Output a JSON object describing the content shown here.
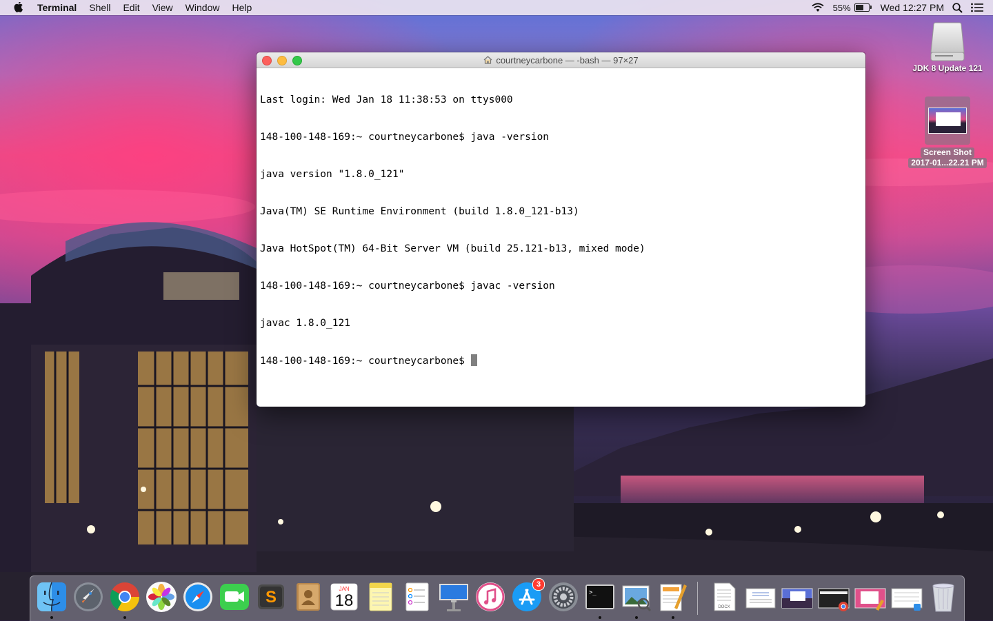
{
  "menubar": {
    "app_name": "Terminal",
    "menus": [
      "Shell",
      "Edit",
      "View",
      "Window",
      "Help"
    ],
    "battery_percent": "55%",
    "battery_level": 0.55,
    "clock": "Wed 12:27 PM"
  },
  "desktop": {
    "icons": [
      {
        "label": "JDK 8 Update 121",
        "icon": "drive-icon"
      },
      {
        "label_line1": "Screen Shot",
        "label_line2": "2017-01...22.21 PM",
        "icon": "screenshot-thumbnail"
      }
    ]
  },
  "terminal": {
    "title": "courtneycarbone — -bash — 97×27",
    "lines": [
      "Last login: Wed Jan 18 11:38:53 on ttys000",
      "148-100-148-169:~ courtneycarbone$ java -version",
      "java version \"1.8.0_121\"",
      "Java(TM) SE Runtime Environment (build 1.8.0_121-b13)",
      "Java HotSpot(TM) 64-Bit Server VM (build 25.121-b13, mixed mode)",
      "148-100-148-169:~ courtneycarbone$ javac -version",
      "javac 1.8.0_121"
    ],
    "prompt": "148-100-148-169:~ courtneycarbone$ "
  },
  "dock": {
    "calendar_month": "JAN",
    "calendar_day": "18",
    "app_store_badge": "3",
    "docx_label": "DOCX",
    "apps": [
      "finder-icon",
      "launchpad-icon",
      "chrome-icon",
      "photos-icon",
      "safari-icon",
      "facetime-icon",
      "sublime-icon",
      "contacts-icon",
      "calendar-icon",
      "notes-icon",
      "reminders-icon",
      "keynote-icon",
      "itunes-icon",
      "app-store-icon",
      "system-preferences-icon",
      "terminal-icon",
      "preview-icon",
      "textedit-icon"
    ],
    "running": [
      "finder-icon",
      "chrome-icon",
      "terminal-icon",
      "preview-icon",
      "textedit-icon"
    ]
  },
  "colors": {
    "sky_pink": "#e8407a",
    "sky_blue": "#5b6ed8",
    "cursor": "#808080",
    "badge": "#ff3b30"
  }
}
